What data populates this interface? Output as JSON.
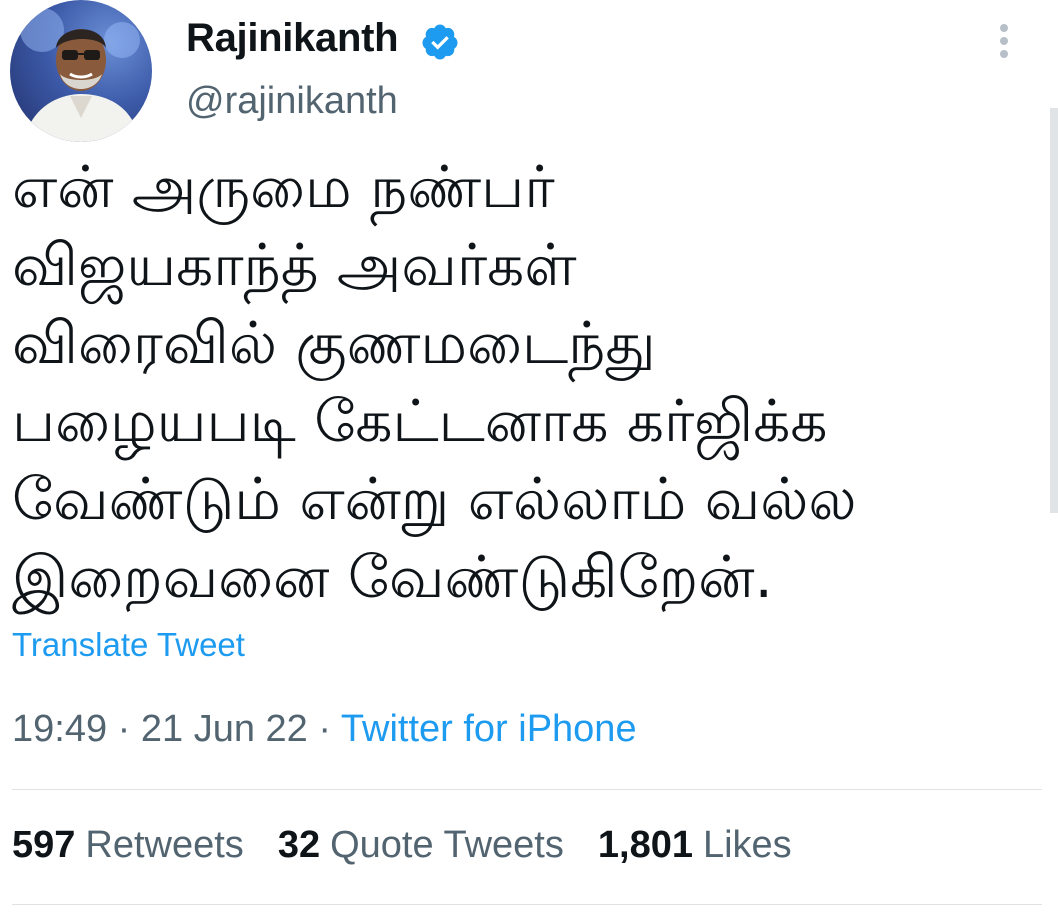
{
  "author": {
    "display_name": "Rajinikanth",
    "handle": "@rajinikanth",
    "verified": true
  },
  "tweet": {
    "lines": [
      "என் அருமை நண்பர்",
      "விஜயகாந்த் அவர்கள்",
      "விரைவில் குணமடைந்து",
      "பழையபடி கேட்டனாக கர்ஜிக்க",
      "வேண்டும் என்று எல்லாம் வல்ல",
      "இறைவனை வேண்டுகிறேன்."
    ],
    "translate_label": "Translate Tweet"
  },
  "meta": {
    "time": "19:49",
    "date": "21 Jun 22",
    "separator": " · ",
    "source": "Twitter for iPhone"
  },
  "stats": {
    "retweets_count": "597",
    "retweets_label": "Retweets",
    "quotes_count": "32",
    "quotes_label": "Quote Tweets",
    "likes_count": "1,801",
    "likes_label": "Likes"
  },
  "colors": {
    "accent": "#1d9bf0",
    "secondary_text": "#536471",
    "primary_text": "#0f1419"
  },
  "icons": {
    "verified": "verified-badge-icon",
    "more": "more-options-icon"
  }
}
